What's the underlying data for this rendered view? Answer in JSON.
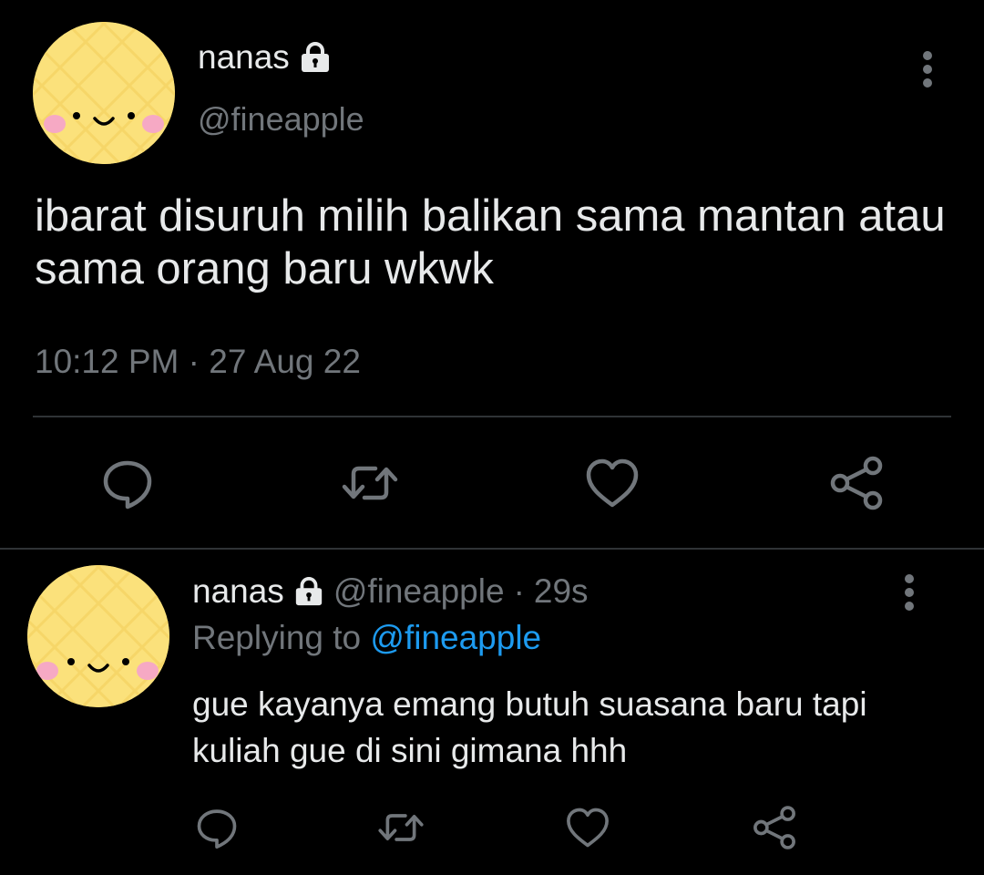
{
  "main_tweet": {
    "display_name": "nanas",
    "handle": "@fineapple",
    "text": "ibarat disuruh milih balikan sama mantan atau sama orang baru wkwk",
    "timestamp": "10:12 PM · 27 Aug 22",
    "icons": {
      "lock": "lock-icon",
      "more": "more-vertical-icon",
      "reply": "reply-icon",
      "retweet": "retweet-icon",
      "like": "heart-icon",
      "share": "share-icon"
    }
  },
  "reply_tweet": {
    "display_name": "nanas",
    "handle": "@fineapple",
    "separator": "·",
    "time": "29s",
    "replying_prefix": "Replying to",
    "replying_to": "@fineapple",
    "text": "gue kayanya emang butuh suasana baru tapi kuliah gue di sini gimana hhh"
  },
  "colors": {
    "background": "#000000",
    "text_primary": "#E7E9EA",
    "text_secondary": "#71767B",
    "accent": "#1D9BF0",
    "avatar": "#FBE17B",
    "divider": "#2F3336"
  }
}
